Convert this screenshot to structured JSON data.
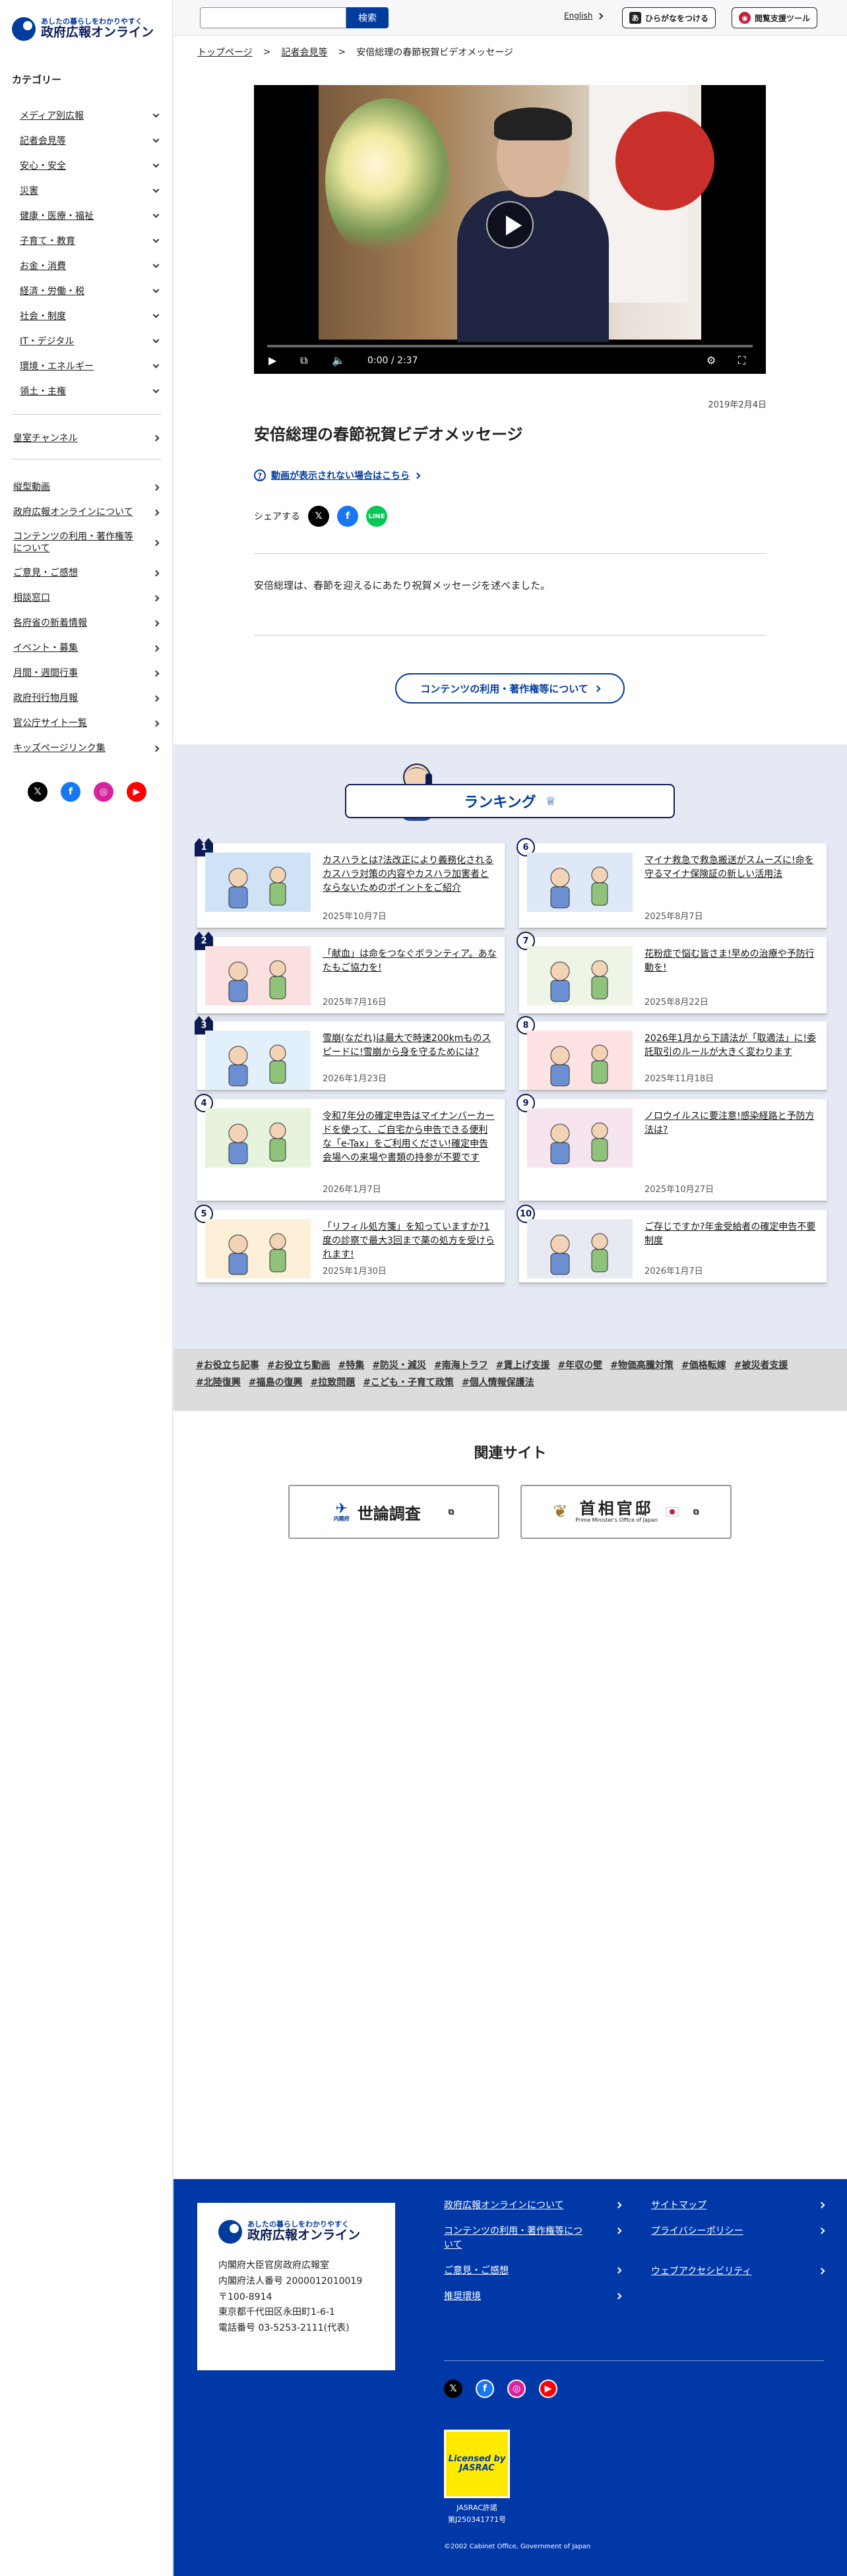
{
  "sidebar": {
    "logo_tag": "あしたの暮らしをわかりやすく",
    "logo_name": "政府広報オンライン",
    "category_heading": "カテゴリー",
    "categories": [
      "メディア別広報",
      "記者会見等",
      "安心・安全",
      "災害",
      "健康・医療・福祉",
      "子育て・教育",
      "お金・消費",
      "経済・労働・税",
      "社会・制度",
      "IT・デジタル",
      "環境・エネルギー",
      "領土・主権"
    ],
    "channel": "皇室チャンネル",
    "links": [
      "縦型動画",
      "政府広報オンラインについて",
      "コンテンツの利用・著作権等について",
      "ご意見・ご感想",
      "相談窓口",
      "各府省の新着情報",
      "イベント・募集",
      "月間・週間行事",
      "政府刊行物月報",
      "官公庁サイト一覧",
      "キッズページリンク集"
    ]
  },
  "topbar": {
    "search_placeholder": "",
    "search_button": "検索",
    "english": "English",
    "furigana": "ひらがなをつける",
    "reader": "閲覧支援ツール"
  },
  "breadcrumb": [
    "トップページ",
    "記者会見等",
    "安倍総理の春節祝賀ビデオメッセージ"
  ],
  "video": {
    "time": "0:00 / 2:37",
    "progress": 0
  },
  "article": {
    "date": "2019年2月4日",
    "title": "安倍総理の春節祝賀ビデオメッセージ",
    "help_link": "動画が表示されない場合はこちら",
    "share_label": "シェアする",
    "description": "安倍総理は、春節を迎えるにあたり祝賀メッセージを述べました。",
    "rights_button": "コンテンツの利用・著作権等について"
  },
  "ranking": {
    "heading": "ランキング",
    "items": [
      {
        "num": "1",
        "title": "カスハラとは?法改正により義務化されるカスハラ対策の内容やカスハラ加害者とならないためのポイントをご紹介",
        "date": "2025年10月7日"
      },
      {
        "num": "2",
        "title": "「献血」は命をつなぐボランティア。あなたもご協力を!",
        "date": "2025年7月16日"
      },
      {
        "num": "3",
        "title": "雪崩(なだれ)は最大で時速200kmものスピードに!雪崩から身を守るためには?",
        "date": "2026年1月23日"
      },
      {
        "num": "4",
        "title": "令和7年分の確定申告はマイナンバーカードを使って、ご自宅から申告できる便利な「e-Tax」をご利用ください!確定申告会場への来場や書類の持参が不要です",
        "date": "2026年1月7日"
      },
      {
        "num": "5",
        "title": "「リフィル処方箋」を知っていますか?1度の診察で最大3回まで薬の処方を受けられます!",
        "date": "2025年1月30日"
      },
      {
        "num": "6",
        "title": "マイナ救急で救急搬送がスムーズに!命を守るマイナ保険証の新しい活用法",
        "date": "2025年8月7日"
      },
      {
        "num": "7",
        "title": "花粉症で悩む皆さま!早めの治療や予防行動を!",
        "date": "2025年8月22日"
      },
      {
        "num": "8",
        "title": "2026年1月から下請法が「取適法」に!委託取引のルールが大きく変わります",
        "date": "2025年11月18日"
      },
      {
        "num": "9",
        "title": "ノロウイルスに要注意!感染経路と予防方法は?",
        "date": "2025年10月27日"
      },
      {
        "num": "10",
        "title": "ご存じですか?年金受給者の確定申告不要制度",
        "date": "2026年1月7日"
      }
    ]
  },
  "tags": [
    "#お役立ち記事",
    "#お役立ち動画",
    "#特集",
    "#防災・減災",
    "#南海トラフ",
    "#賃上げ支援",
    "#年収の壁",
    "#物価高騰対策",
    "#価格転嫁",
    "#被災者支援",
    "#北陸復興",
    "#福島の復興",
    "#拉致問題",
    "#こども・子育て政策",
    "#個人情報保護法"
  ],
  "related": {
    "heading": "関連サイト",
    "sites": [
      "世論調査",
      "首相官邸"
    ],
    "kantei_sub": "Prime Minister's Office of Japan",
    "cabinet_sub": "内閣府"
  },
  "footer": {
    "address": [
      "内閣府大臣官房政府広報室",
      "内閣府法人番号 2000012010019",
      "〒100-8914",
      "東京都千代田区永田町1-6-1",
      "電話番号 03-5253-2111(代表)"
    ],
    "links_col1": [
      "政府広報オンラインについて",
      "コンテンツの利用・著作権等について",
      "ご意見・ご感想",
      "推奨環境"
    ],
    "links_col2": [
      "サイトマップ",
      "プライバシーポリシー",
      "ウェブアクセシビリティ"
    ],
    "jasrac_badge": "Licensed by JASRAC",
    "jasrac_text": [
      "JASRAC許諾",
      "第J250341771号"
    ],
    "copyright": "©2002 Cabinet Office, Government of Japan"
  },
  "colors": {
    "brand": "#003b9e",
    "footer": "#0038a8",
    "x": "#000000",
    "facebook": "#1877f2",
    "instagram": "#d6249f",
    "youtube": "#ff0000",
    "line": "#06c755"
  }
}
